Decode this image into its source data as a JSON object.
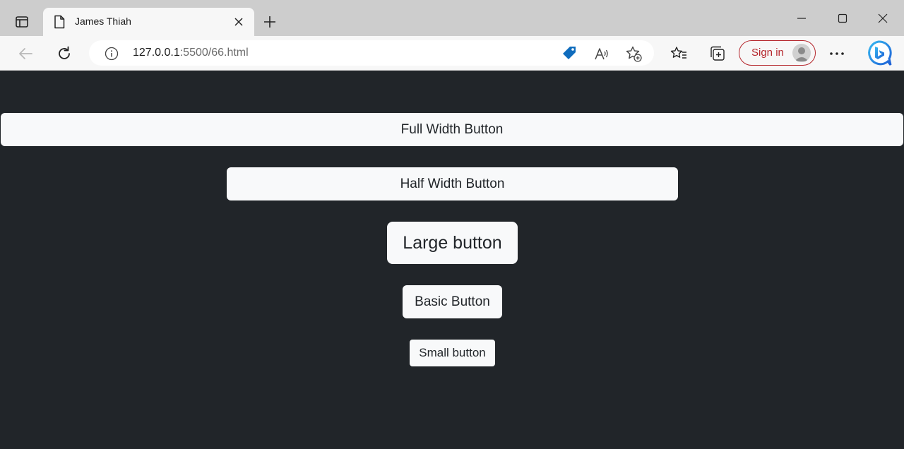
{
  "browser": {
    "tab": {
      "title": "James Thiah"
    },
    "address": {
      "host": "127.0.0.1",
      "path": ":5500/66.html"
    },
    "signin_label": "Sign in",
    "icons": [
      "tab-actions-icon",
      "document-icon",
      "close-icon",
      "plus-icon",
      "minimize-icon",
      "maximize-icon",
      "close-window-icon",
      "back-arrow-icon",
      "refresh-icon",
      "info-icon",
      "tag-icon",
      "read-aloud-icon",
      "add-favorite-icon",
      "favorites-icon",
      "collections-icon",
      "avatar-icon",
      "more-icon",
      "bing-icon"
    ],
    "colors": {
      "signin_accent": "#b5272d",
      "tag_blue": "#0f6cbd",
      "page_bg": "#212529",
      "button_bg": "#f8f9fa"
    }
  },
  "page": {
    "buttons": {
      "full": "Full Width Button",
      "half": "Half Width Button",
      "large": "Large button",
      "basic": "Basic Button",
      "small": "Small button"
    }
  }
}
